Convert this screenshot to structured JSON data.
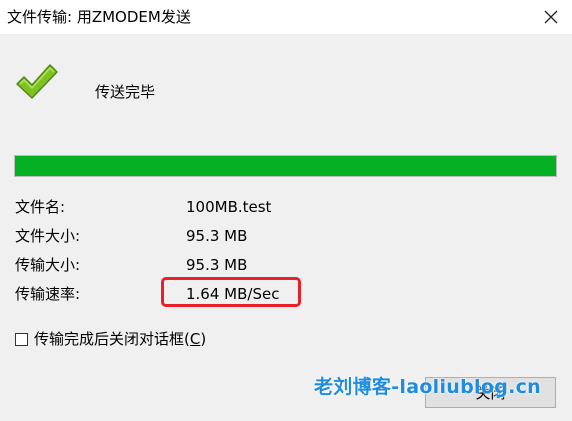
{
  "window": {
    "title": "文件传输: 用ZMODEM发送"
  },
  "status": {
    "text": "传送完毕",
    "icon": "checkmark-icon",
    "icon_color": "#7dc21e"
  },
  "progress": {
    "percent": 100,
    "color": "#06b025"
  },
  "details": [
    {
      "label": "文件名:",
      "value": "100MB.test"
    },
    {
      "label": "文件大小:",
      "value": "95.3 MB"
    },
    {
      "label": "传输大小:",
      "value": "95.3 MB"
    },
    {
      "label": "传输速率:",
      "value": "1.64 MB/Sec"
    }
  ],
  "checkbox": {
    "label_main": "传输完成后关闭对话框(",
    "label_key": "C",
    "label_end": ")",
    "checked": false
  },
  "buttons": {
    "close_label": "关闭"
  },
  "watermark": {
    "text": "老刘博客-laoliublog.cn",
    "color": "#1f8ce0"
  },
  "highlight": {
    "color": "#e8202a"
  }
}
